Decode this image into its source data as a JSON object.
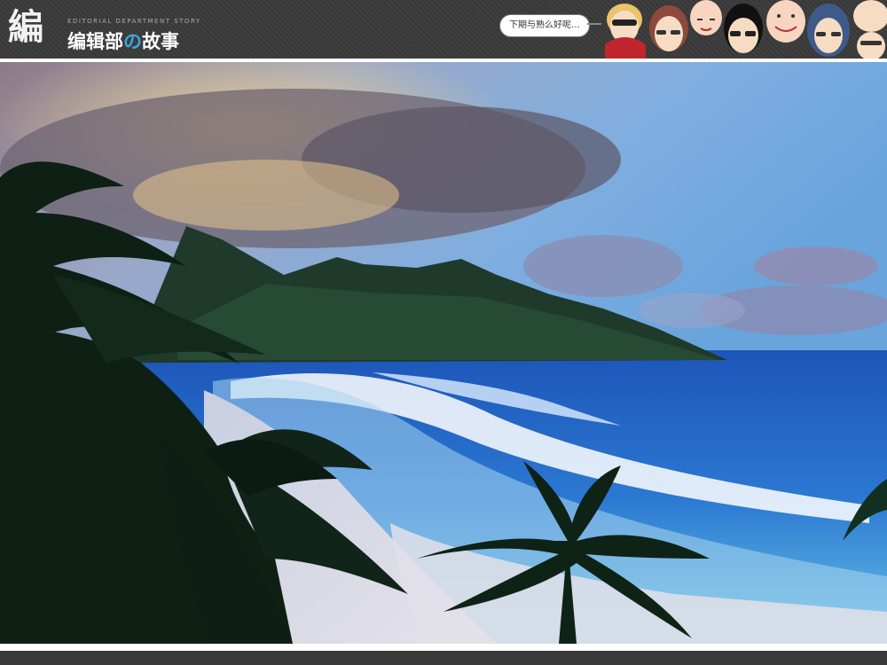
{
  "header": {
    "logo_mark": "編",
    "subtitle": "EDITORIAL DEPARTMENT STORY",
    "title_part1": "编辑部",
    "title_part2": "の",
    "title_part3": "故事",
    "speech_bubble": "下期与熟么好呢…"
  },
  "colors": {
    "header_bg": "#3a3a3a",
    "accent": "#39a7e0",
    "frame": "#ffffff"
  },
  "icons": [
    "cartoon-character-faces-icon"
  ]
}
